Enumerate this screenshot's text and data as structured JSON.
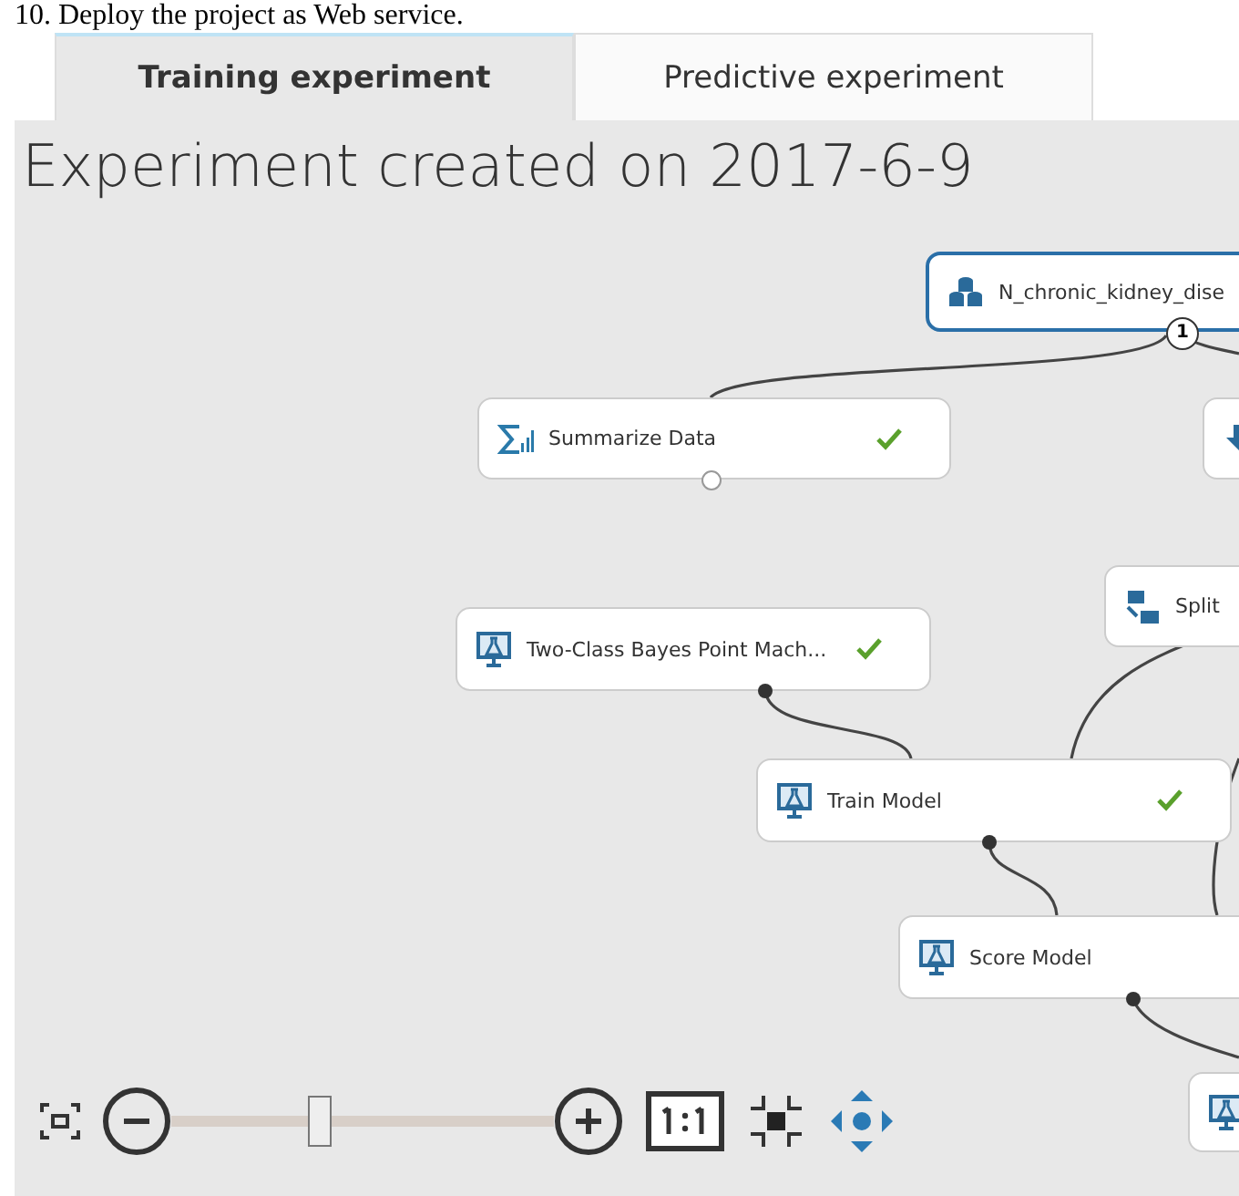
{
  "caption": "10. Deploy the project as Web service.",
  "tabs": [
    {
      "label": "Training experiment",
      "selected": true
    },
    {
      "label": "Predictive experiment",
      "selected": false
    }
  ],
  "title": "Experiment created on 2017-6-9",
  "nodes": [
    {
      "kind": "dataset",
      "label": "N_chronic_kidney_dise",
      "selected": true,
      "completed": false,
      "port": "1"
    },
    {
      "kind": "summarize",
      "label": "Summarize Data",
      "selected": false,
      "completed": true
    },
    {
      "kind": "transform",
      "selected": false
    },
    {
      "kind": "split",
      "label": "Split",
      "selected": false,
      "completed": false
    },
    {
      "kind": "model",
      "label": "Two-Class Bayes Point Mach...",
      "selected": false,
      "completed": true
    },
    {
      "kind": "model",
      "label": "Train Model",
      "selected": false,
      "completed": true
    },
    {
      "kind": "model",
      "label": "Score Model",
      "selected": false,
      "completed": false
    },
    {
      "kind": "model",
      "selected": false
    }
  ],
  "zoom": {
    "level": 0.39
  }
}
